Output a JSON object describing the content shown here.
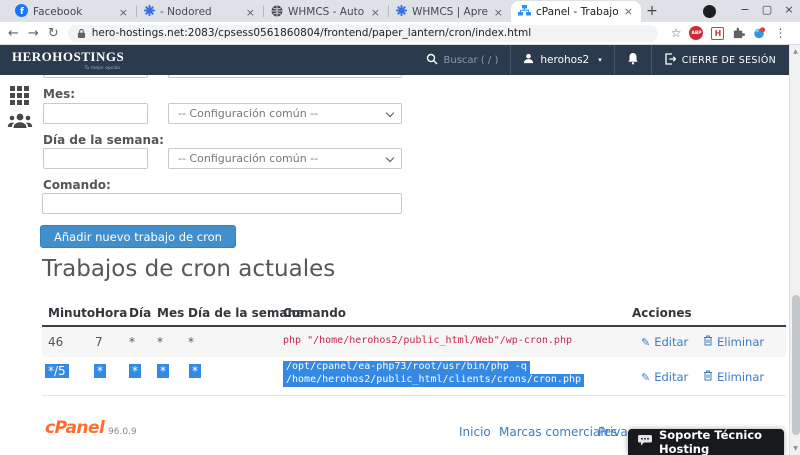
{
  "browser": {
    "tabs": [
      {
        "title": "Facebook",
        "icon": "facebook-icon"
      },
      {
        "title": "- Nodored",
        "icon": "nodored-icon"
      },
      {
        "title": "WHMCS - Automation Sta",
        "icon": "globe-icon"
      },
      {
        "title": "WHMCS | Aprende con N",
        "icon": "whmcs-icon"
      },
      {
        "title": "cPanel - Trabajos de cron",
        "icon": "cpanel-icon"
      }
    ],
    "new_tab_glyph": "+",
    "close_glyph": "×",
    "window": {
      "minimize": "−",
      "maximize": "▢",
      "close": "×"
    },
    "nav": {
      "back": "←",
      "forward": "→",
      "reload": "↻"
    },
    "url": "hero-hostings.net:2083/cpsess0561860804/frontend/paper_lantern/cron/index.html",
    "bookmark_glyph": "☆",
    "adblock_label": "ABP",
    "h_ext_label": "H",
    "menu_glyph": "⋮"
  },
  "header": {
    "logo": "HEROHOSTINGS",
    "tagline": "Tu mejor opción",
    "search_placeholder": "Buscar ( / )",
    "username": "herohos2",
    "caret_glyph": "▾",
    "logout_label": "CIERRE DE SESIÓN"
  },
  "form": {
    "month_label": "Mes:",
    "weekday_label": "Día de la semana:",
    "command_label": "Comando:",
    "common_setting_option": "-- Configuración común --",
    "submit_label": "Añadir nuevo trabajo de cron"
  },
  "cron_table": {
    "heading": "Trabajos de cron actuales",
    "columns": [
      "Minuto",
      "Hora",
      "Día",
      "Mes",
      "Día de la semana",
      "Comando",
      "Acciones"
    ],
    "rows": [
      {
        "minute": "46",
        "hour": "7",
        "day": "*",
        "month": "*",
        "weekday": "*",
        "command": "php \"/home/herohos2/public_html/Web\"/wp-cron.php",
        "selected": false
      },
      {
        "minute": "*/5",
        "hour": "*",
        "day": "*",
        "month": "*",
        "weekday": "*",
        "command_line1": "/opt/cpanel/ea-php73/root/usr/bin/php -q",
        "command_line2": "/home/herohos2/public_html/clients/crons/cron.php",
        "selected": true
      }
    ],
    "edit_label": "Editar",
    "delete_label": "Eliminar",
    "edit_icon_glyph": "✎"
  },
  "footer": {
    "brand": "cPanel",
    "version": "96.0.9",
    "links": [
      "Inicio",
      "Marcas comerciales",
      "Privacy"
    ],
    "support_label": "Soporte Técnico Hosting"
  },
  "scrollbar": {
    "up_glyph": "▲",
    "down_glyph": "▼"
  },
  "colors": {
    "header_bg": "#2b3b4d",
    "button_primary": "#4190cd",
    "selection_blue": "#3389e3",
    "command_red": "#c7254e",
    "link_blue": "#3d7dc0",
    "cpanel_orange": "#ff6c2c"
  }
}
